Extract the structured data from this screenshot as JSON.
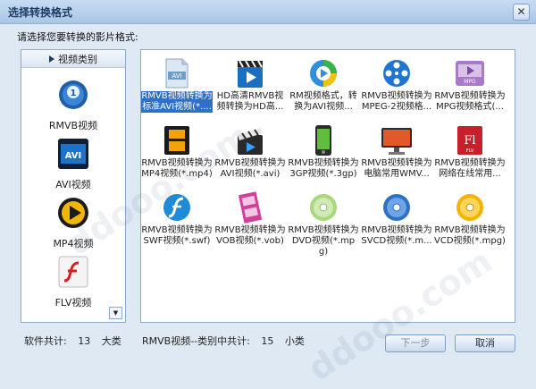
{
  "window": {
    "title": "选择转换格式",
    "close_glyph": "✕"
  },
  "prompt_text": "请选择您要转换的影片格式:",
  "sidebar": {
    "header": "视频类别",
    "categories": [
      {
        "label": "RMVB视频",
        "icon": "rmvb-icon"
      },
      {
        "label": "AVI视频",
        "icon": "avi-icon"
      },
      {
        "label": "MP4视频",
        "icon": "mp4-icon"
      },
      {
        "label": "FLV视频",
        "icon": "flv-icon"
      }
    ]
  },
  "formats": [
    {
      "label": "RMVB视频转换为标准AVI视频(*....",
      "icon": "avi-file-icon",
      "selected": true
    },
    {
      "label": "HD高清RMVB视频转换为HD高...",
      "icon": "hd-clapper-icon"
    },
    {
      "label": "RM视频格式，转换为AVI视频...",
      "icon": "player-icon"
    },
    {
      "label": "RMVB视频转换为MPEG-2视频格...",
      "icon": "film-reel-icon"
    },
    {
      "label": "RMVB视频转换为MPG视频格式(...",
      "icon": "mpg-icon"
    },
    {
      "label": "RMVB视频转换为MP4视频(*.mp4)",
      "icon": "mp4-film-icon"
    },
    {
      "label": "RMVB视频转换为AVI视频(*.avi)",
      "icon": "clapper-icon"
    },
    {
      "label": "RMVB视频转换为3GP视频(*.3gp)",
      "icon": "phone-icon"
    },
    {
      "label": "RMVB视频转换为电脑常用WMV...",
      "icon": "monitor-icon"
    },
    {
      "label": "RMVB视频转换为网络在线常用...",
      "icon": "flash-icon"
    },
    {
      "label": "RMVB视频转换为SWF视频(*.swf)",
      "icon": "swf-icon"
    },
    {
      "label": "RMVB视频转换为VOB视频(*.vob)",
      "icon": "film-strip-icon"
    },
    {
      "label": "RMVB视频转换为DVD视频(*.mpg)",
      "icon": "dvd-disc-icon"
    },
    {
      "label": "RMVB视频转换为SVCD视频(*.m...",
      "icon": "svcd-disc-icon"
    },
    {
      "label": "RMVB视频转换为VCD视频(*.mpg)",
      "icon": "vcd-disc-icon"
    }
  ],
  "footer": {
    "software_label": "软件共计:",
    "software_count": "13",
    "software_unit": "大类",
    "category_label": "RMVB视频--类别中共计:",
    "category_count": "15",
    "category_unit": "小类",
    "next_button": "下一步",
    "cancel_button": "取消"
  },
  "colors": {
    "selection": "#2f6fc7",
    "title_bar": "#b8d0ec",
    "window_bg": "#dfe9f4"
  }
}
